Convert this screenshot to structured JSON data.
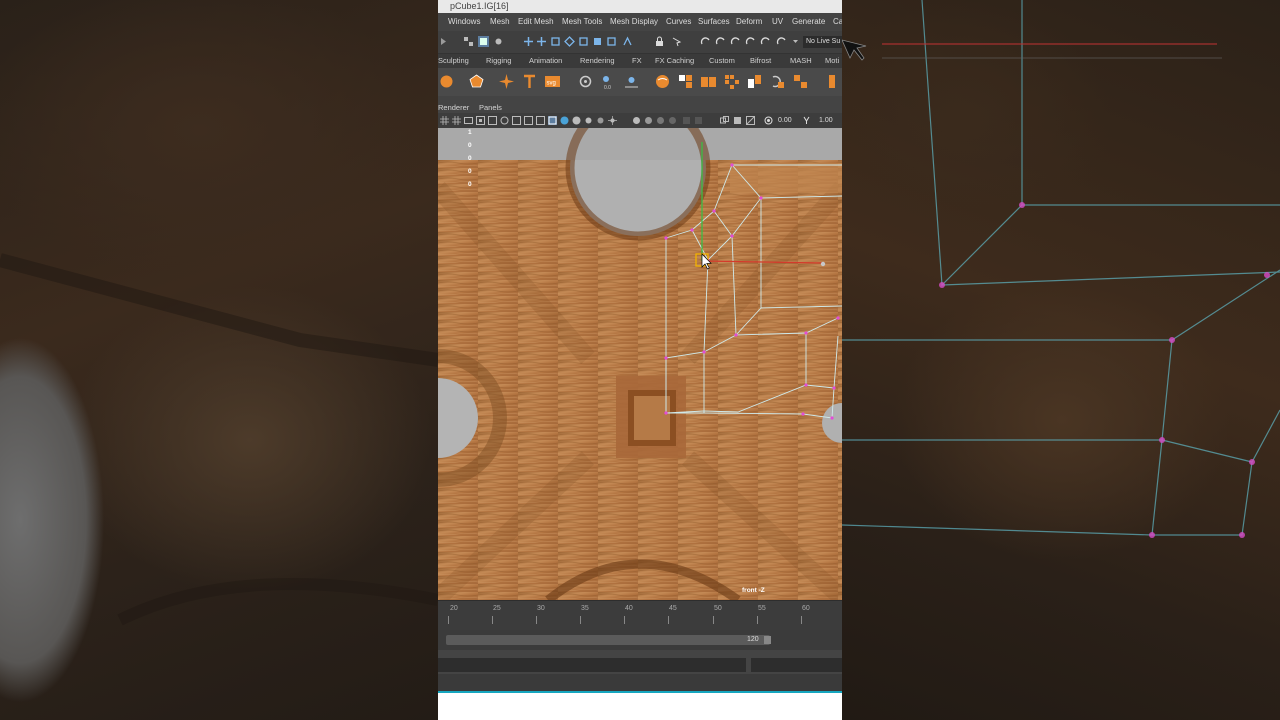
{
  "window": {
    "title": "pCube1.IG[16]"
  },
  "menus": [
    "Windows",
    "Mesh",
    "Edit Mesh",
    "Mesh Tools",
    "Mesh Display",
    "Curves",
    "Surfaces",
    "Deform",
    "UV",
    "Generate",
    "Ca"
  ],
  "status_line": {
    "live_surface": "No Live Su"
  },
  "shelf_tabs": [
    "Sculpting",
    "Rigging",
    "Animation",
    "Rendering",
    "FX",
    "FX Caching",
    "Custom",
    "Bifrost",
    "MASH",
    "Moti"
  ],
  "shelf_icons": [
    "poly-sphere-icon",
    "poly-soccer-icon",
    "sparkle-icon",
    "text-icon",
    "svg-icon",
    "crease-icon",
    "measure-icon",
    "distance-icon",
    "separate-icon",
    "combine-icon",
    "bool-icon",
    "extract-icon",
    "uv-unfold-icon",
    "duplicate-icon",
    "paint-icon"
  ],
  "panel_menus": [
    "Renderer",
    "Panels"
  ],
  "panel_toolbar": {
    "exposure": "0.00",
    "gamma": "1.00"
  },
  "hud": [
    "1",
    "0",
    "0",
    "0",
    "0"
  ],
  "viewport": {
    "camera": "front -Z"
  },
  "time_slider": {
    "ticks": [
      "20",
      "25",
      "30",
      "35",
      "40",
      "45",
      "50",
      "55",
      "60"
    ]
  },
  "range_slider": {
    "end": "120"
  },
  "colors": {
    "accent": "#16a6bf",
    "wood": "#b07440",
    "wireframe": "#cfe9ea",
    "vertex": "#e24dd6",
    "selection": "#f2b300"
  }
}
